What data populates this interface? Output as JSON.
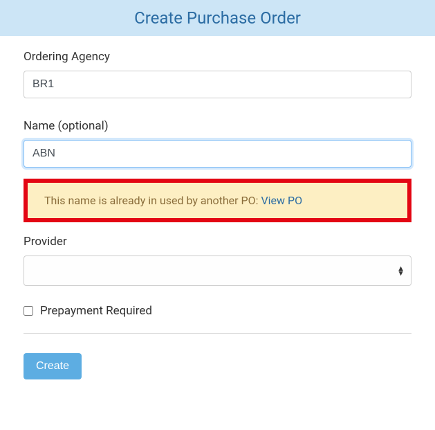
{
  "header": {
    "title": "Create Purchase Order"
  },
  "form": {
    "ordering_agency": {
      "label": "Ordering Agency",
      "value": "BR1"
    },
    "name": {
      "label": "Name (optional)",
      "value": "ABN"
    },
    "alert": {
      "text": "This name is already in used by another PO: ",
      "link_text": "View PO"
    },
    "provider": {
      "label": "Provider",
      "value": ""
    },
    "prepayment": {
      "label": "Prepayment Required",
      "checked": false
    },
    "submit": {
      "label": "Create"
    }
  }
}
